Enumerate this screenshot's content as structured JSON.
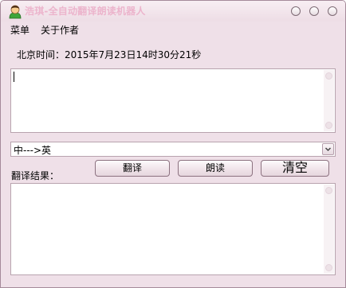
{
  "window": {
    "title": "浩琪-全自动翻译朗读机器人",
    "icon": "user-avatar-icon",
    "controls": [
      "minimize-icon",
      "maximize-icon",
      "close-icon"
    ]
  },
  "menu": {
    "items": [
      {
        "label": "菜单"
      },
      {
        "label": "关于作者"
      }
    ]
  },
  "time": {
    "text": "北京时间：2015年7月23日14时30分21秒"
  },
  "input": {
    "value": ""
  },
  "direction": {
    "selected": "中--->英"
  },
  "buttons": {
    "translate": "翻译",
    "read": "朗读",
    "clear": "清空"
  },
  "result": {
    "label": "翻译结果：",
    "value": ""
  },
  "colors": {
    "window_bg": "#efe0e8",
    "title_text": "#ecb4cc",
    "border": "#b8a3ae"
  }
}
